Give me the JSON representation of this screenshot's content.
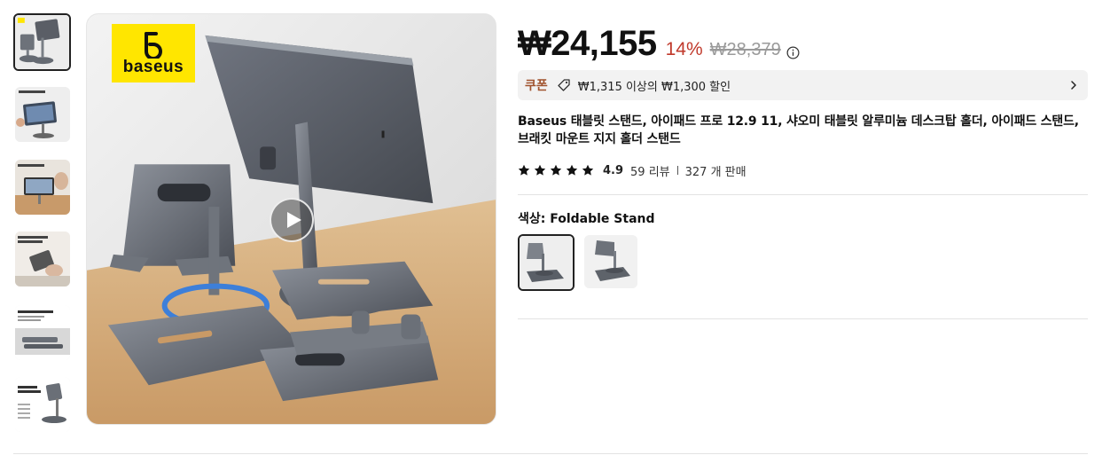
{
  "product": {
    "brand_logo_text": "baseus",
    "title": "Baseus 태블릿 스탠드, 아이패드 프로 12.9 11, 샤오미 태블릿 알루미늄 데스크탑 홀더, 아이패드 스탠드, 브래킷 마운트 지지 홀더 스탠드"
  },
  "price": {
    "current": "₩24,155",
    "discount": "14%",
    "original": "₩28,379"
  },
  "coupon": {
    "label": "쿠폰",
    "text": "₩1,315 이상의 ₩1,300 할인"
  },
  "rating": {
    "value": "4.9",
    "stars": 5,
    "reviews": "59 리뷰",
    "sold": "327 개 판매"
  },
  "variant": {
    "label": "색상: Foldable Stand",
    "options": [
      "Foldable Stand",
      "Stand"
    ]
  },
  "thumbnails": {
    "count": 6,
    "captions": [
      "360° Rotatable Design",
      "Height Adjustable",
      "One-Hand Operation Highly Portable",
      "Stable and Sturdy without Wobbling",
      "Rotatable & Foldable Design"
    ]
  },
  "colors": {
    "accent_red": "#c0392b",
    "coupon_brown": "#a0522d",
    "brand_yellow": "#ffe600"
  },
  "icons": [
    "play-icon",
    "info-icon",
    "tag-icon",
    "chevron-right-icon",
    "star-icon"
  ]
}
